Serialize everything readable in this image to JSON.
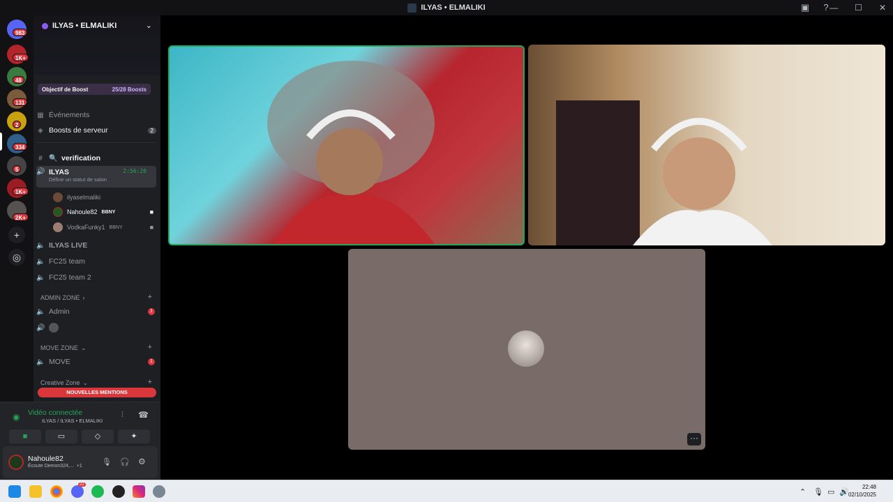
{
  "window": {
    "title": "ILYAS • ELMALIKI"
  },
  "servers": [
    {
      "badge": "983"
    },
    {
      "badge": "1K+"
    },
    {
      "badge": "48"
    },
    {
      "badge": "131"
    },
    {
      "badge": "2"
    },
    {
      "badge": "334"
    },
    {
      "badge": "5"
    },
    {
      "badge": "1K+"
    },
    {
      "badge": "2K+"
    }
  ],
  "guild": {
    "name": "ILYAS • ELMALIKI",
    "boost_label": "Objectif de Boost",
    "boost_count": "25/28 Boosts"
  },
  "channels": {
    "events": "Événements",
    "boosts": "Boosts de serveur",
    "boosts_count": "2",
    "verification": "verification",
    "voice_active": "ILYAS",
    "voice_timer": "2:56:20",
    "voice_status": "Définir un statut de salon",
    "members": [
      {
        "name": "ilyaselmaliki",
        "tag": ""
      },
      {
        "name": "Nahoule82",
        "tag": "BBNY"
      },
      {
        "name": "VodkaFunky1",
        "tag": "BBNY"
      }
    ],
    "live": "ILYAS LIVE",
    "fc25": "FC25 team",
    "fc25b": "FC25 team 2",
    "cat_admin": "ADMIN ZONE",
    "admin": "Admin",
    "admin_badge": "1",
    "cat_move": "MOVE ZONE",
    "move": "MOVE",
    "move_badge": "1",
    "cat_creative": "Creative Zone",
    "new_mentions": "NOUVELLES MENTIONS"
  },
  "voice": {
    "status": "Vidéo connectée",
    "location": "ILYAS / ILYAS • ELMALIKI"
  },
  "user": {
    "name": "Nahoule82",
    "activity": "Écoute Demon324,...",
    "extra": "+1"
  },
  "taskbar": {
    "time": "22:48",
    "date": "02/10/2025",
    "badge": "22"
  },
  "colors": {
    "accent": "#23a55a",
    "danger": "#da373c",
    "tile_bg": "#796b68"
  }
}
